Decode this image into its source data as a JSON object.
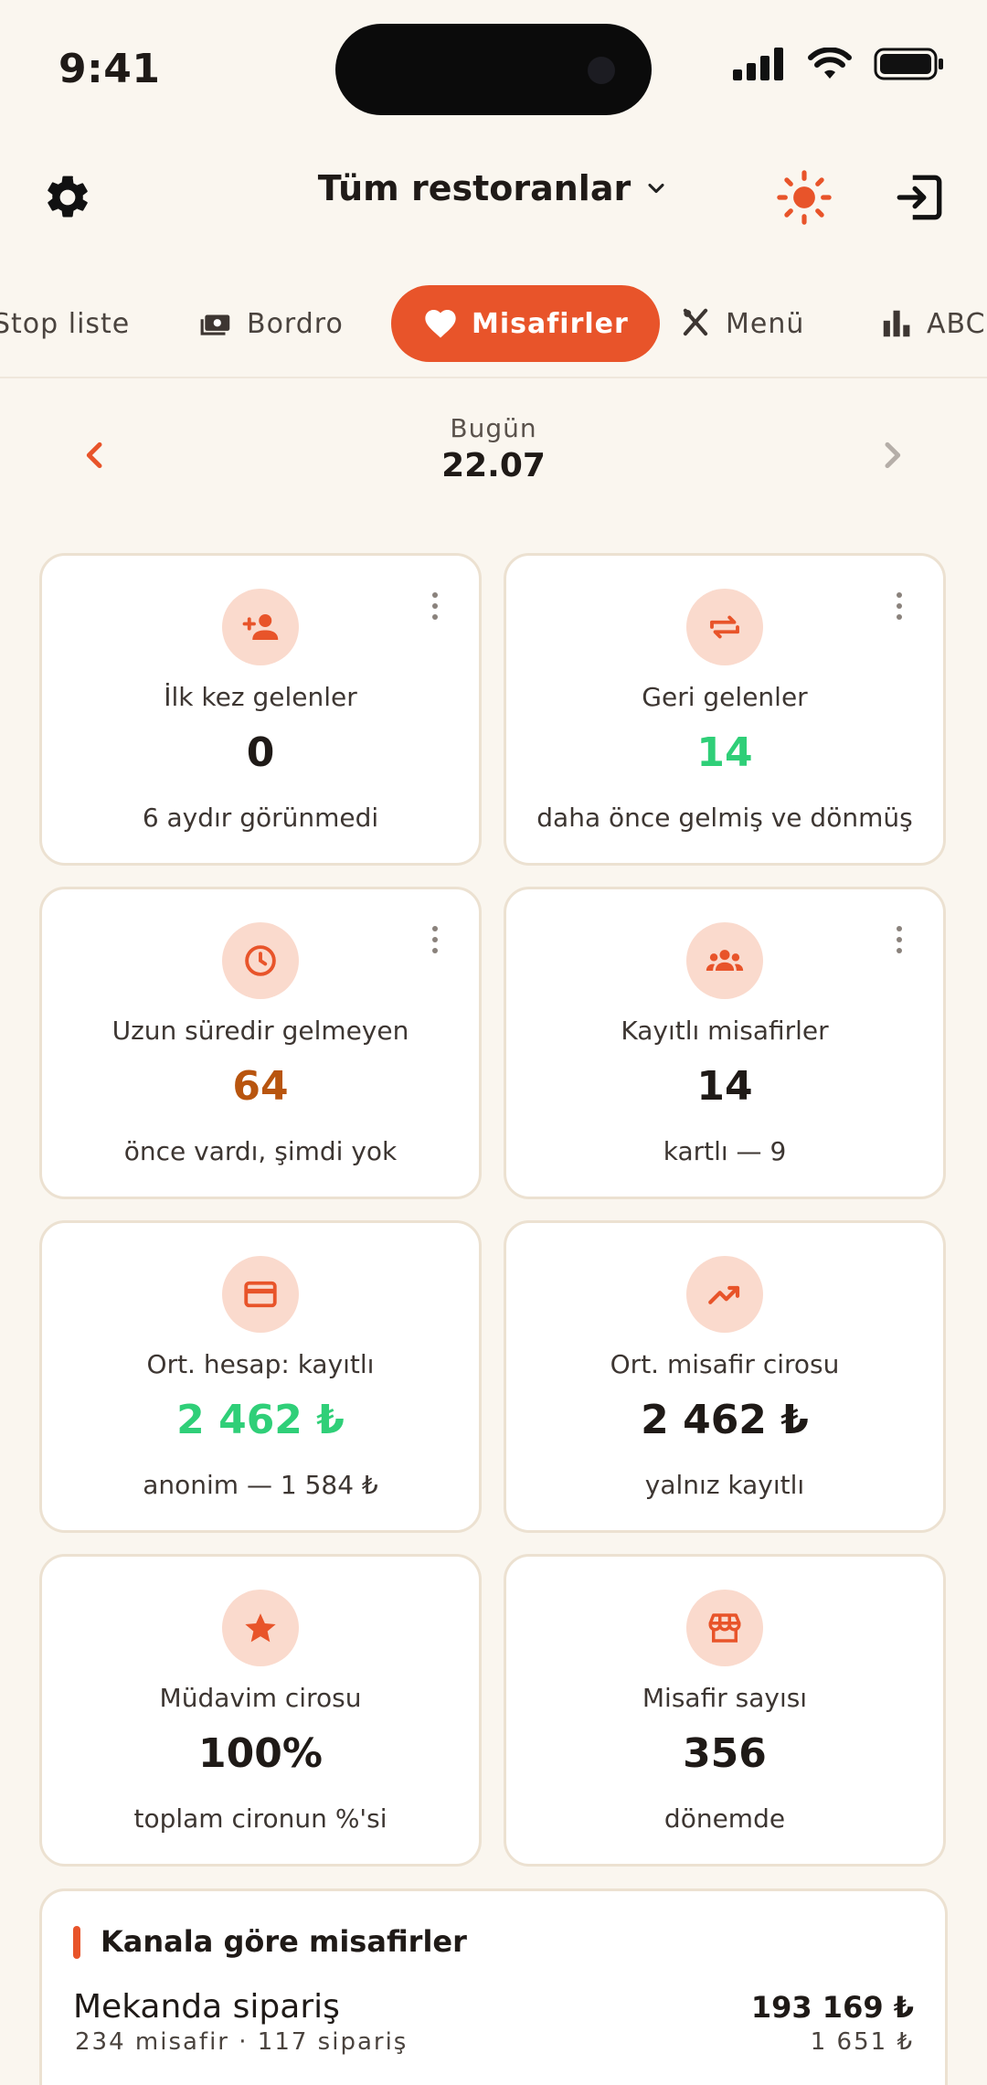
{
  "status_bar": {
    "time": "9:41"
  },
  "header": {
    "title": "Tüm restoranlar"
  },
  "tabs": [
    {
      "label": "Stop liste",
      "icon": "list-icon"
    },
    {
      "label": "Bordro",
      "icon": "money-icon"
    },
    {
      "label": "Misafirler",
      "icon": "heart-icon",
      "active": true
    },
    {
      "label": "Menü",
      "icon": "cutlery-icon"
    },
    {
      "label": "ABC",
      "icon": "bar-chart-icon"
    }
  ],
  "date_nav": {
    "label": "Bugün",
    "value": "22.07"
  },
  "cards": [
    {
      "icon": "add-person-icon",
      "title": "İlk kez gelenler",
      "value": "0",
      "sub": "6 aydır görünmedi",
      "has_menu": true
    },
    {
      "icon": "repeat-icon",
      "title": "Geri gelenler",
      "value": "14",
      "sub": "daha önce gelmiş ve dönmüş",
      "has_menu": true
    },
    {
      "icon": "clock-icon",
      "title": "Uzun süredir gelmeyen",
      "value": "64",
      "sub": "önce vardı, şimdi yok",
      "has_menu": true
    },
    {
      "icon": "group-icon",
      "title": "Kayıtlı misafirler",
      "value": "14",
      "sub": "kartlı — 9",
      "has_menu": true
    },
    {
      "icon": "credit-card-icon",
      "title": "Ort. hesap: kayıtlı",
      "value": "2 462 ₺",
      "sub": "anonim — 1 584 ₺",
      "has_menu": false
    },
    {
      "icon": "trending-up-icon",
      "title": "Ort. misafir cirosu",
      "value": "2 462 ₺",
      "sub": "yalnız kayıtlı",
      "has_menu": false
    },
    {
      "icon": "star-icon",
      "title": "Müdavim cirosu",
      "value": "100%",
      "sub": "toplam cironun %'si",
      "has_menu": false
    },
    {
      "icon": "store-icon",
      "title": "Misafir sayısı",
      "value": "356",
      "sub": "dönemde",
      "has_menu": false
    }
  ],
  "channel_section": {
    "title": "Kanala göre misafirler",
    "rows": [
      {
        "name": "Mekanda sipariş",
        "meta": "234 misafir · 117 sipariş",
        "total": "193 169 ₺",
        "avg": "1 651 ₺"
      }
    ]
  },
  "colors": {
    "accent": "#e8542a",
    "positive": "#2fcf78",
    "warning": "#b8550f",
    "background": "#faf6ef"
  }
}
